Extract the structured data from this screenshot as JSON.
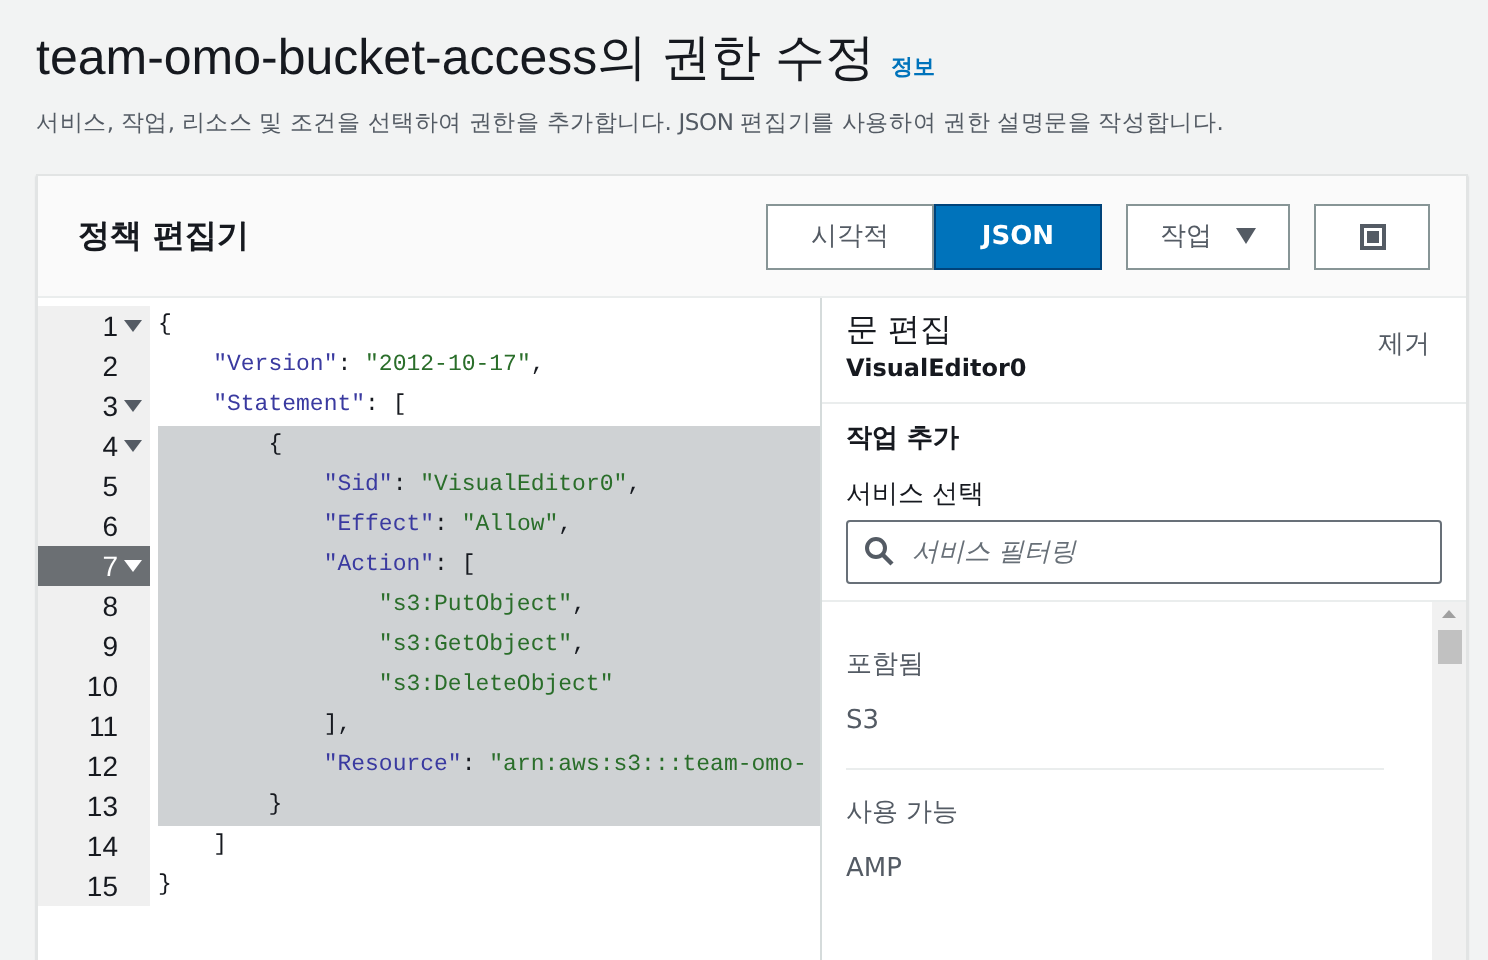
{
  "page": {
    "title": "team-omo-bucket-access의 권한 수정",
    "info_link": "정보",
    "description": "서비스, 작업, 리소스 및 조건을 선택하여 권한을 추가합니다. JSON 편집기를 사용하여 권한 설명문을 작성합니다."
  },
  "editor": {
    "title": "정책 편집기",
    "mode_tabs": [
      {
        "label": "시각적",
        "selected": false
      },
      {
        "label": "JSON",
        "selected": true
      }
    ],
    "actions_button": "작업",
    "code_lines": [
      {
        "number": "1",
        "foldable": true,
        "active": false,
        "selected": false,
        "tokens": [
          {
            "kind": "punct",
            "text": "{"
          }
        ]
      },
      {
        "number": "2",
        "foldable": false,
        "active": false,
        "selected": false,
        "tokens": [
          {
            "kind": "key",
            "text": "    \"Version\""
          },
          {
            "kind": "punct",
            "text": ": "
          },
          {
            "kind": "string",
            "text": "\"2012-10-17\""
          },
          {
            "kind": "punct",
            "text": ","
          }
        ]
      },
      {
        "number": "3",
        "foldable": true,
        "active": false,
        "selected": false,
        "tokens": [
          {
            "kind": "key",
            "text": "    \"Statement\""
          },
          {
            "kind": "punct",
            "text": ": ["
          }
        ]
      },
      {
        "number": "4",
        "foldable": true,
        "active": false,
        "selected": true,
        "tokens": [
          {
            "kind": "punct",
            "text": "        {"
          }
        ]
      },
      {
        "number": "5",
        "foldable": false,
        "active": false,
        "selected": true,
        "tokens": [
          {
            "kind": "key",
            "text": "            \"Sid\""
          },
          {
            "kind": "punct",
            "text": ": "
          },
          {
            "kind": "string",
            "text": "\"VisualEditor0\""
          },
          {
            "kind": "punct",
            "text": ","
          }
        ]
      },
      {
        "number": "6",
        "foldable": false,
        "active": false,
        "selected": true,
        "tokens": [
          {
            "kind": "key",
            "text": "            \"Effect\""
          },
          {
            "kind": "punct",
            "text": ": "
          },
          {
            "kind": "string",
            "text": "\"Allow\""
          },
          {
            "kind": "punct",
            "text": ","
          }
        ]
      },
      {
        "number": "7",
        "foldable": true,
        "active": true,
        "selected": true,
        "tokens": [
          {
            "kind": "key",
            "text": "            \"Action\""
          },
          {
            "kind": "punct",
            "text": ": ["
          }
        ]
      },
      {
        "number": "8",
        "foldable": false,
        "active": false,
        "selected": true,
        "tokens": [
          {
            "kind": "string",
            "text": "                \"s3:PutObject\""
          },
          {
            "kind": "punct",
            "text": ","
          }
        ]
      },
      {
        "number": "9",
        "foldable": false,
        "active": false,
        "selected": true,
        "tokens": [
          {
            "kind": "string",
            "text": "                \"s3:GetObject\""
          },
          {
            "kind": "punct",
            "text": ","
          }
        ]
      },
      {
        "number": "10",
        "foldable": false,
        "active": false,
        "selected": true,
        "tokens": [
          {
            "kind": "string",
            "text": "                \"s3:DeleteObject\""
          }
        ]
      },
      {
        "number": "11",
        "foldable": false,
        "active": false,
        "selected": true,
        "tokens": [
          {
            "kind": "punct",
            "text": "            ],"
          }
        ]
      },
      {
        "number": "12",
        "foldable": false,
        "active": false,
        "selected": true,
        "tokens": [
          {
            "kind": "key",
            "text": "            \"Resource\""
          },
          {
            "kind": "punct",
            "text": ": "
          },
          {
            "kind": "string",
            "text": "\"arn:aws:s3:::team-omo-"
          }
        ]
      },
      {
        "number": "13",
        "foldable": false,
        "active": false,
        "selected": true,
        "tokens": [
          {
            "kind": "punct",
            "text": "        }"
          }
        ]
      },
      {
        "number": "14",
        "foldable": false,
        "active": false,
        "selected": false,
        "tokens": [
          {
            "kind": "punct",
            "text": "    ]"
          }
        ]
      },
      {
        "number": "15",
        "foldable": false,
        "active": false,
        "selected": false,
        "tokens": [
          {
            "kind": "punct",
            "text": "}"
          }
        ]
      }
    ]
  },
  "statement_panel": {
    "title": "문 편집",
    "statement_id": "VisualEditor0",
    "remove_link": "제거",
    "add_actions": "작업 추가",
    "service_label": "서비스 선택",
    "search": {
      "placeholder": "서비스 필터링"
    },
    "groups": [
      {
        "heading": "포함됨",
        "items": [
          "S3"
        ]
      },
      {
        "heading": "사용 가능",
        "items": [
          "AMP"
        ]
      }
    ]
  }
}
